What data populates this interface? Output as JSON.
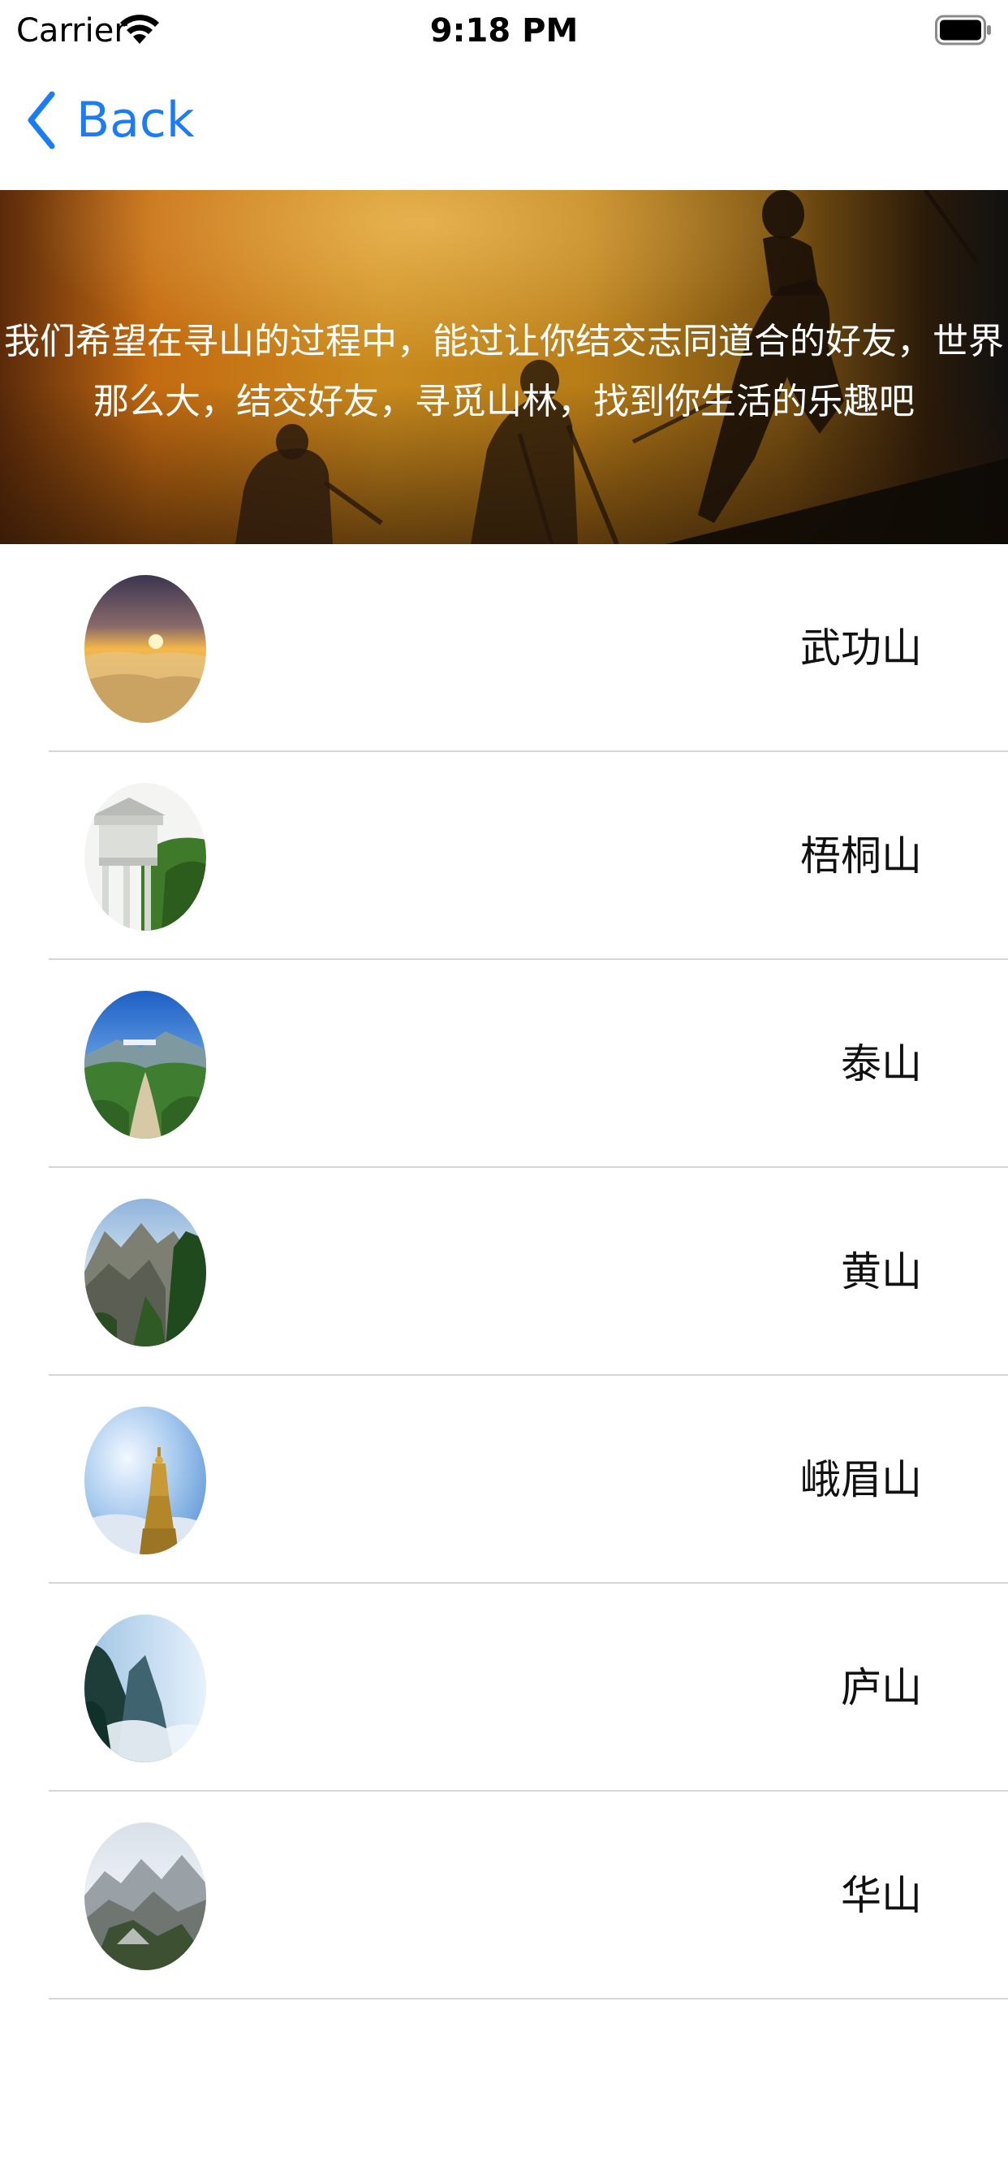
{
  "status_bar": {
    "carrier": "Carrier",
    "time": "9:18 PM",
    "wifi_icon": "wifi-icon",
    "battery_icon": "battery-icon"
  },
  "nav": {
    "back_label": "Back",
    "back_icon": "chevron-left-icon",
    "accent_color": "#1b7cf6"
  },
  "banner": {
    "line1": "我们希望在寻山的过程中，能过让你结交志同道合的好友，世界",
    "line2": "那么大，结交好友，寻觅山林，找到你生活的乐趣吧"
  },
  "mountains": [
    {
      "name": "武功山"
    },
    {
      "name": "梧桐山"
    },
    {
      "name": "泰山"
    },
    {
      "name": "黄山"
    },
    {
      "name": "峨眉山"
    },
    {
      "name": "庐山"
    },
    {
      "name": "华山"
    }
  ]
}
